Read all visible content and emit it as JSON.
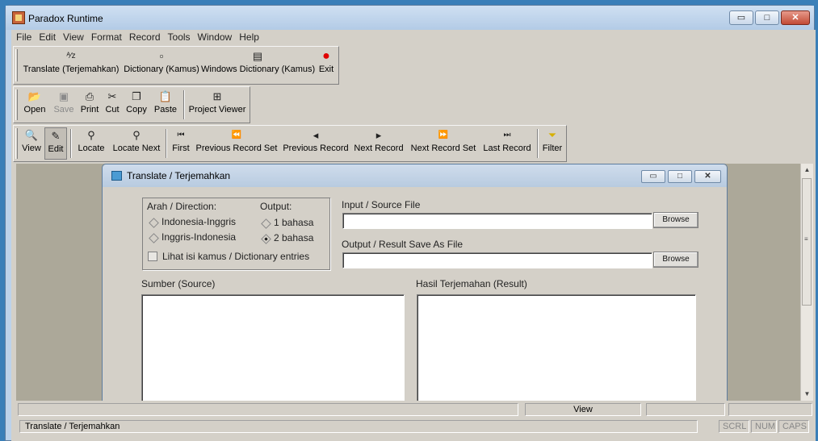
{
  "app": {
    "title": "Paradox Runtime"
  },
  "window_controls": {
    "minimize": "▭",
    "maximize": "□",
    "close": "✕"
  },
  "menu": [
    "File",
    "Edit",
    "View",
    "Format",
    "Record",
    "Tools",
    "Window",
    "Help"
  ],
  "toolbar_app": [
    {
      "label": "Translate (Terjemahkan)",
      "icon": "translate-icon",
      "glyph": "ᴬ⁄z"
    },
    {
      "label": "Dictionary (Kamus)",
      "icon": "dictionary-icon",
      "glyph": "▫"
    },
    {
      "label": "Windows Dictionary (Kamus)",
      "icon": "windows-dictionary-icon",
      "glyph": "▤"
    },
    {
      "label": "Exit",
      "icon": "exit-icon",
      "glyph": "●"
    }
  ],
  "toolbar_edit": [
    {
      "label": "Open",
      "icon": "open-folder-icon",
      "glyph": "📂",
      "disabled": false
    },
    {
      "label": "Save",
      "icon": "save-icon",
      "glyph": "▣",
      "disabled": true
    },
    {
      "label": "Print",
      "icon": "print-icon",
      "glyph": "⎙",
      "disabled": false
    },
    {
      "label": "Cut",
      "icon": "cut-icon",
      "glyph": "✂",
      "disabled": false
    },
    {
      "label": "Copy",
      "icon": "copy-icon",
      "glyph": "❐",
      "disabled": false
    },
    {
      "label": "Paste",
      "icon": "paste-icon",
      "glyph": "📋",
      "disabled": false
    },
    {
      "label": "Project Viewer",
      "icon": "project-viewer-icon",
      "glyph": "⊞",
      "disabled": false
    }
  ],
  "toolbar_nav": [
    {
      "label": "View",
      "icon": "view-icon",
      "glyph": "🔍"
    },
    {
      "label": "Edit",
      "icon": "edit-icon",
      "glyph": "✎"
    },
    {
      "label": "Locate",
      "icon": "locate-icon",
      "glyph": "⚲"
    },
    {
      "label": "Locate Next",
      "icon": "locate-next-icon",
      "glyph": "⚲"
    },
    {
      "label": "First",
      "icon": "first-record-icon",
      "glyph": "⏮"
    },
    {
      "label": "Previous Record Set",
      "icon": "previous-record-set-icon",
      "glyph": "⏪"
    },
    {
      "label": "Previous Record",
      "icon": "previous-record-icon",
      "glyph": "◂"
    },
    {
      "label": "Next Record",
      "icon": "next-record-icon",
      "glyph": "▸"
    },
    {
      "label": "Next Record Set",
      "icon": "next-record-set-icon",
      "glyph": "⏩"
    },
    {
      "label": "Last Record",
      "icon": "last-record-icon",
      "glyph": "⏭"
    },
    {
      "label": "Filter",
      "icon": "filter-icon",
      "glyph": "⏷"
    }
  ],
  "dialog": {
    "title": "Translate / Terjemahkan",
    "direction_label": "Arah / Direction:",
    "direction_options": [
      "Indonesia-Inggris",
      "Inggris-Indonesia"
    ],
    "output_label": "Output:",
    "output_options": [
      "1 bahasa",
      "2 bahasa"
    ],
    "output_selected": "2 bahasa",
    "dictionary_checkbox": "Lihat isi kamus / Dictionary entries",
    "input_label": "Input / Source File",
    "input_value": "",
    "output_file_label": "Output / Result Save As File",
    "output_file_value": "",
    "browse_label": "Browse",
    "source_label": "Sumber (Source)",
    "result_label": "Hasil Terjemahan (Result)"
  },
  "status": {
    "mode": "View",
    "window_name": "Translate / Terjemahkan",
    "indicators": [
      "SCRL",
      "NUM",
      "CAPS"
    ]
  },
  "colors": {
    "exit_red": "#e00000",
    "filter_yellow": "#f0d000",
    "mdi_background": "#aca899"
  }
}
